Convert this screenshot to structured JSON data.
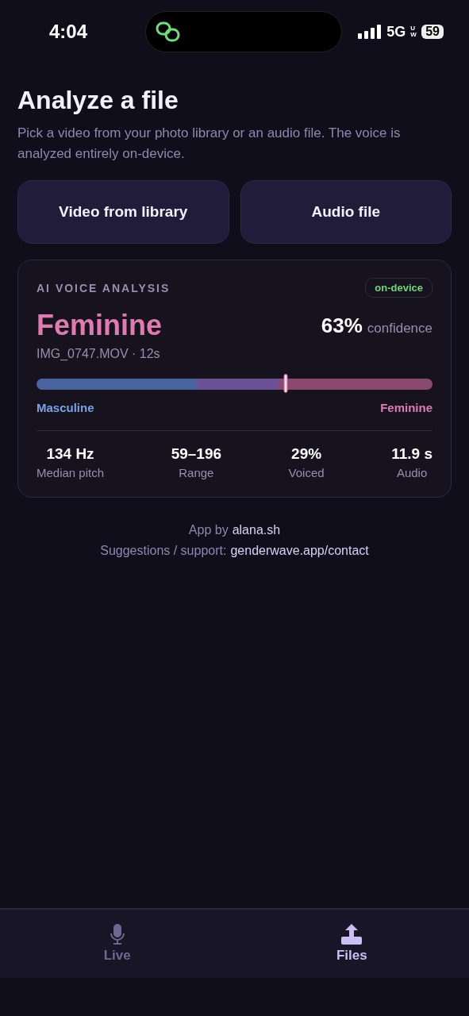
{
  "status_bar": {
    "time": "4:04",
    "network": "5G",
    "network_sub": "UW",
    "battery": "59"
  },
  "header": {
    "title": "Analyze a file",
    "subtitle": "Pick a video from your photo library or an audio file. The voice is analyzed entirely on-device."
  },
  "actions": [
    "Video from library",
    "Audio file"
  ],
  "analysis": {
    "label": "AI VOICE ANALYSIS",
    "badge": "on-device",
    "result": "Feminine",
    "confidence_value": "63%",
    "confidence_label": "confidence",
    "file": "IMG_0747.MOV · 12s",
    "level": 0.63,
    "scale_left": "Masculine",
    "scale_right": "Feminine",
    "stats": [
      {
        "value": "134 Hz",
        "label": "Median pitch"
      },
      {
        "value": "59–196",
        "label": "Range"
      },
      {
        "value": "29%",
        "label": "Voiced"
      },
      {
        "value": "11.9 s",
        "label": "Audio"
      }
    ]
  },
  "footer": [
    {
      "text": "App by",
      "link": "alana.sh"
    },
    {
      "text": "Suggestions / support:",
      "link": "genderwave.app/contact"
    }
  ],
  "tabs": [
    {
      "label": "Live",
      "kind": "mic",
      "selected": false
    },
    {
      "label": "Files",
      "kind": "upload",
      "selected": true
    }
  ]
}
